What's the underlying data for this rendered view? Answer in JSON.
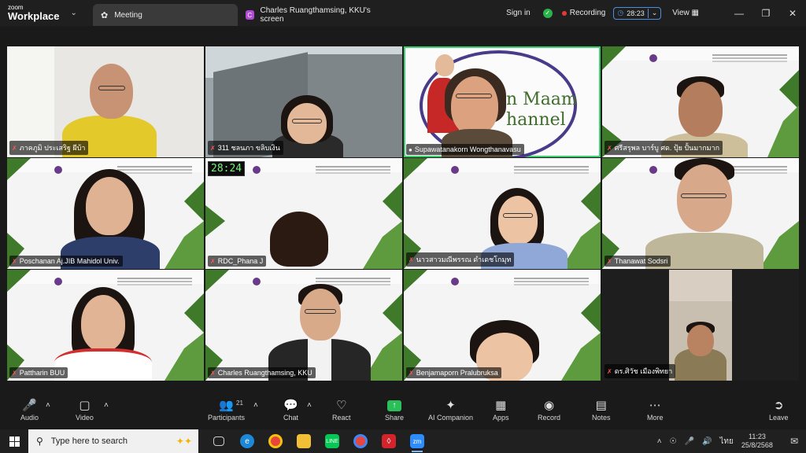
{
  "titlebar": {
    "brand_top": "zoom",
    "brand_bottom": "Workplace",
    "tabs": [
      {
        "label": "Meeting"
      },
      {
        "label": "Charles Ruangthamsing, KKU's screen",
        "badge": "C"
      }
    ],
    "sign_in": "Sign in",
    "recording": "Recording",
    "timer": "28:23",
    "view": "View"
  },
  "participants": [
    {
      "name": "ภาคภูมิ ประเสริฐ ผีบ้า"
    },
    {
      "name": "311 ชลนภา ขลิบเงิน"
    },
    {
      "name": "Supawatanakorn Wongthanavasu",
      "slide_text": "n Maam\nhannel"
    },
    {
      "name": "ศรีสรุพล บาร์บู ศด. ปุ้ย ปั้นมากมาก"
    },
    {
      "name": "Poschanan Aj.JIB Mahidol Univ."
    },
    {
      "name": "RDC_Phana J",
      "countdown": "28:24"
    },
    {
      "name": "นาวสาวมณีพรรณ ดำเดชโกมุท"
    },
    {
      "name": "Thanawat Sodsri"
    },
    {
      "name": "Pattharin BUU"
    },
    {
      "name": "Charles Ruangthamsing, KKU"
    },
    {
      "name": "Benjamaporn Pralubruksa"
    },
    {
      "name": "ดร.ศิวัช เมืองพิทยา"
    }
  ],
  "controls": {
    "audio": "Audio",
    "video": "Video",
    "participants": "Participants",
    "participant_count": "21",
    "chat": "Chat",
    "react": "React",
    "share": "Share",
    "ai_companion": "AI Companion",
    "apps": "Apps",
    "record": "Record",
    "notes": "Notes",
    "more": "More",
    "leave": "Leave"
  },
  "taskbar": {
    "search_placeholder": "Type here to search",
    "time": "11:23",
    "date": "25/8/2568",
    "lang": "ไทย"
  },
  "colors": {
    "highlight": "#3bd16f",
    "recording_dot": "#e53935",
    "share_green": "#2bbf5a",
    "slide_green": "#3f7a2a"
  }
}
